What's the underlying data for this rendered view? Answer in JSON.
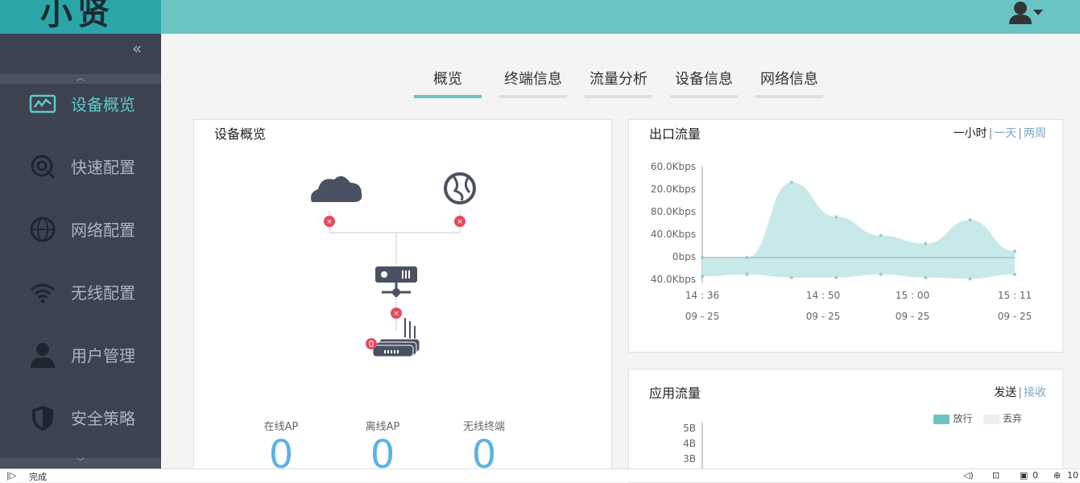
{
  "app": {
    "logo_text": "小贤"
  },
  "header": {
    "user_icon": "user-icon"
  },
  "sidebar": {
    "collapse_glyph": "«",
    "items": [
      {
        "label": "设备概览",
        "icon": "chart-line-icon",
        "active": true
      },
      {
        "label": "快速配置",
        "icon": "quick-config-icon",
        "active": false
      },
      {
        "label": "网络配置",
        "icon": "globe-icon",
        "active": false
      },
      {
        "label": "无线配置",
        "icon": "wifi-icon",
        "active": false
      },
      {
        "label": "用户管理",
        "icon": "user-icon",
        "active": false
      },
      {
        "label": "安全策略",
        "icon": "shield-icon",
        "active": false
      }
    ]
  },
  "tabs": [
    {
      "label": "概览",
      "active": true
    },
    {
      "label": "终端信息",
      "active": false
    },
    {
      "label": "流量分析",
      "active": false
    },
    {
      "label": "设备信息",
      "active": false
    },
    {
      "label": "网络信息",
      "active": false
    }
  ],
  "device_overview": {
    "title": "设备概览",
    "offline_count_badge": "0",
    "stats": [
      {
        "label": "在线AP",
        "value": "0"
      },
      {
        "label": "离线AP",
        "value": "0"
      },
      {
        "label": "无线终端",
        "value": "0"
      }
    ]
  },
  "egress": {
    "title": "出口流量",
    "range_options": [
      "一小时",
      "一天",
      "两周"
    ],
    "range_separator": "|"
  },
  "app_traffic": {
    "title": "应用流量",
    "mode_options": [
      "发送",
      "接收"
    ],
    "mode_separator": "|",
    "legend": [
      "放行",
      "丢弃"
    ],
    "y_ticks": [
      "5B",
      "4B",
      "3B"
    ]
  },
  "colors": {
    "accent": "#6ac4c4",
    "sidebar_bg": "#3c4250",
    "stat_value": "#5bb3e3",
    "error_badge": "#e6495e",
    "area_fill": "#c8e9ea"
  },
  "chart_data": {
    "type": "area",
    "title": "出口流量",
    "y_tick_labels": [
      "60.0Kbps",
      "20.0Kbps",
      "80.0Kbps",
      "40.0Kbps",
      "0bps",
      "40.0Kbps"
    ],
    "x_tick_labels": [
      {
        "time": "14 : 36",
        "date": "09 - 25"
      },
      {
        "time": "14 : 50",
        "date": "09 - 25"
      },
      {
        "time": "15 : 00",
        "date": "09 - 25"
      },
      {
        "time": "15 : 11",
        "date": "09 - 25"
      }
    ],
    "series": [
      {
        "values": [
          0,
          0,
          120,
          65,
          35,
          22,
          60,
          10
        ]
      },
      {
        "values": [
          -30,
          -27,
          -32,
          -32,
          -27,
          -32,
          -34,
          -27
        ]
      }
    ],
    "ylim": [
      -40,
      140
    ]
  },
  "statusbar": {
    "text": "完成",
    "counter": "0",
    "zoom": "10"
  }
}
